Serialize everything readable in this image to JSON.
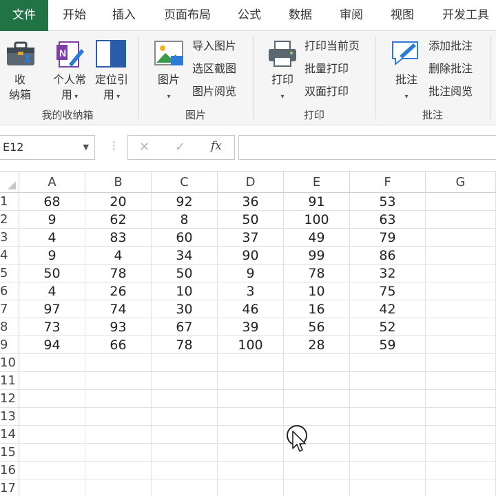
{
  "tabs": [
    {
      "label": "文件",
      "active": true
    },
    {
      "label": "开始"
    },
    {
      "label": "插入"
    },
    {
      "label": "页面布局"
    },
    {
      "label": "公式"
    },
    {
      "label": "数据"
    },
    {
      "label": "审阅"
    },
    {
      "label": "视图"
    },
    {
      "label": "开发工具"
    }
  ],
  "ribbon": {
    "storage_group": {
      "label": "我的收纳箱",
      "storage_box_line1": "收",
      "storage_box_line2": "纳箱",
      "personal_line1": "个人常",
      "personal_line2": "用",
      "locate_line1": "定位引",
      "locate_line2": "用"
    },
    "picture_group": {
      "label": "图片",
      "picture_big": "图片",
      "import_picture": "导入图片",
      "region_screenshot": "选区截图",
      "picture_browse": "图片阅览"
    },
    "print_group": {
      "label": "打印",
      "print_big": "打印",
      "print_current": "打印当前页",
      "batch_print": "批量打印",
      "duplex_print": "双面打印"
    },
    "comment_group": {
      "label": "批注",
      "comment_big": "批注",
      "add_comment": "添加批注",
      "delete_comment": "删除批注",
      "comment_browse": "批注阅览"
    }
  },
  "formula_bar": {
    "name_box": "E12",
    "dots": "⋮",
    "cancel": "✕",
    "confirm": "✓",
    "fx": "fx",
    "value": ""
  },
  "columns": [
    "A",
    "B",
    "C",
    "D",
    "E",
    "F",
    "G"
  ],
  "rows": [
    "1",
    "2",
    "3",
    "4",
    "5",
    "6",
    "7",
    "8",
    "9",
    "10",
    "11",
    "12",
    "13",
    "14",
    "15",
    "16",
    "17"
  ],
  "cells": [
    [
      "68",
      "20",
      "92",
      "36",
      "91",
      "53"
    ],
    [
      "9",
      "62",
      "8",
      "50",
      "100",
      "63"
    ],
    [
      "4",
      "83",
      "60",
      "37",
      "49",
      "79"
    ],
    [
      "9",
      "4",
      "34",
      "90",
      "99",
      "86"
    ],
    [
      "50",
      "78",
      "50",
      "9",
      "78",
      "32"
    ],
    [
      "4",
      "26",
      "10",
      "3",
      "10",
      "75"
    ],
    [
      "97",
      "74",
      "30",
      "46",
      "16",
      "42"
    ],
    [
      "73",
      "93",
      "67",
      "39",
      "56",
      "52"
    ],
    [
      "94",
      "66",
      "78",
      "100",
      "28",
      "59"
    ]
  ],
  "colors": {
    "accent": "#217346"
  }
}
